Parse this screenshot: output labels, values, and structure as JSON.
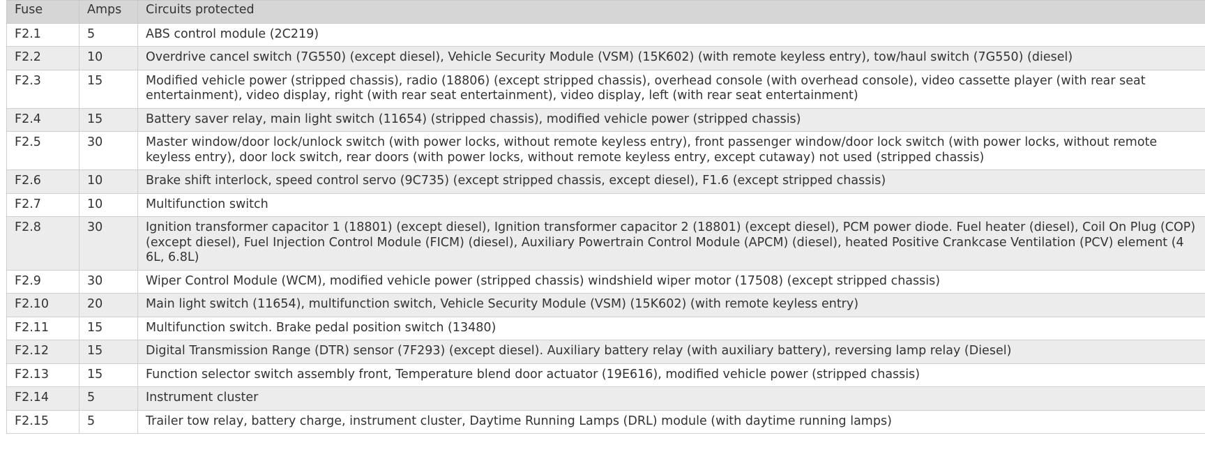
{
  "headers": {
    "fuse": "Fuse",
    "amps": "Amps",
    "circuits": "Circuits protected"
  },
  "rows": [
    {
      "fuse": "F2.1",
      "amps": "5",
      "circuits": "ABS control module (2C219)"
    },
    {
      "fuse": "F2.2",
      "amps": "10",
      "circuits": "Overdrive cancel switch (7G550) (except diesel), Vehicle Security Module (VSM) (15K602) (with remote keyless entry), tow/haul switch (7G550) (diesel)"
    },
    {
      "fuse": "F2.3",
      "amps": "15",
      "circuits": "Modified vehicle power (stripped chassis), radio (18806) (except stripped chassis), overhead console (with overhead console), video cassette player (with rear seat entertainment), video display, right (with rear seat entertainment), video display, left (with rear seat entertainment)"
    },
    {
      "fuse": "F2.4",
      "amps": "15",
      "circuits": "Battery saver relay, main light switch (11654) (stripped chassis), modified vehicle power (stripped chassis)"
    },
    {
      "fuse": "F2.5",
      "amps": "30",
      "circuits": "Master window/door lock/unlock switch (with power locks, without remote keyless entry), front passenger window/door lock switch (with power locks, without remote keyless entry), door lock switch, rear doors (with power locks, without remote keyless entry, except cutaway) not used (stripped chassis)"
    },
    {
      "fuse": "F2.6",
      "amps": "10",
      "circuits": "Brake shift interlock, speed control servo (9C735) (except stripped chassis, except diesel), F1.6 (except stripped chassis)"
    },
    {
      "fuse": "F2.7",
      "amps": "10",
      "circuits": "Multifunction switch"
    },
    {
      "fuse": "F2.8",
      "amps": "30",
      "circuits": "Ignition transformer capacitor 1 (18801) (except diesel), Ignition transformer capacitor 2 (18801) (except diesel), PCM power diode. Fuel heater (diesel), Coil On Plug (COP) (except diesel), Fuel Injection Control Module (FICM) (diesel), Auxiliary Powertrain Control Module (APCM) (diesel), heated Positive Crankcase Ventilation (PCV) element (4 6L, 6.8L)"
    },
    {
      "fuse": "F2.9",
      "amps": "30",
      "circuits": "Wiper Control Module (WCM), modified vehicle power (stripped chassis) windshield wiper motor (17508) (except stripped chassis)"
    },
    {
      "fuse": "F2.10",
      "amps": "20",
      "circuits": "Main light switch (11654), multifunction switch, Vehicle Security Module (VSM) (15K602) (with remote keyless entry)"
    },
    {
      "fuse": "F2.11",
      "amps": "15",
      "circuits": "Multifunction switch. Brake pedal position switch (13480)"
    },
    {
      "fuse": "F2.12",
      "amps": "15",
      "circuits": "Digital Transmission Range (DTR) sensor (7F293) (except diesel). Auxiliary battery relay (with auxiliary battery), reversing lamp relay (Diesel)"
    },
    {
      "fuse": "F2.13",
      "amps": "15",
      "circuits": "Function selector switch assembly front, Temperature blend door actuator (19E616), modified vehicle power (stripped chassis)"
    },
    {
      "fuse": "F2.14",
      "amps": "5",
      "circuits": "Instrument cluster"
    },
    {
      "fuse": "F2.15",
      "amps": "5",
      "circuits": "Trailer tow relay, battery charge, instrument cluster, Daytime Running Lamps (DRL) module (with daytime running lamps)"
    }
  ]
}
